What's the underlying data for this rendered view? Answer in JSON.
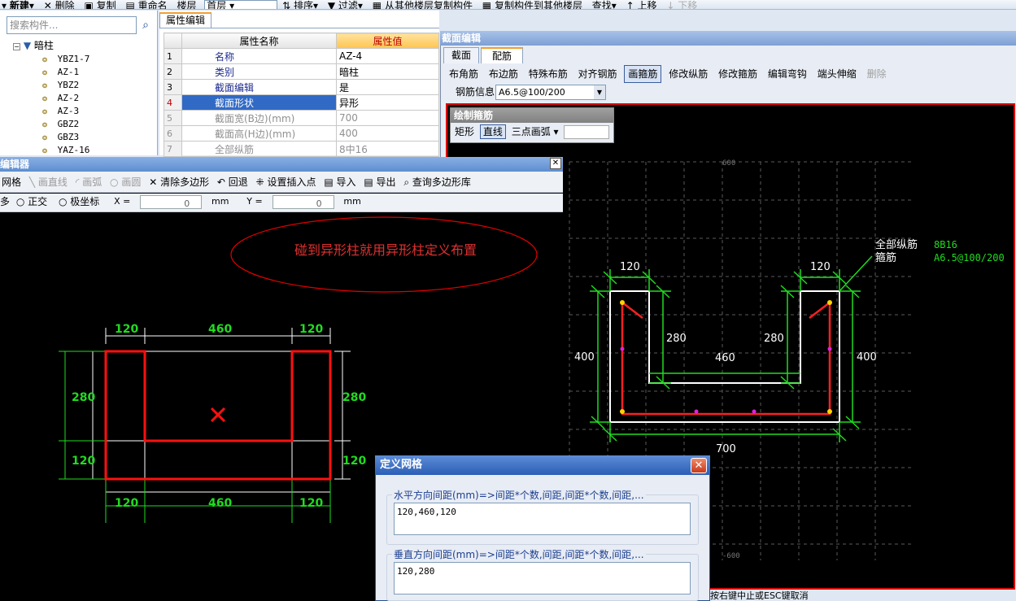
{
  "toolbar": {
    "items": [
      "新建",
      "删除",
      "复制",
      "重命名",
      "楼层",
      "首层",
      "排序",
      "过滤",
      "从其他楼层复制构件",
      "复制构件到其他楼层",
      "查找",
      "上移",
      "下移"
    ]
  },
  "tree": {
    "search_placeholder": "搜索构件...",
    "root": "暗柱",
    "items": [
      "YBZ1-7",
      "AZ-1",
      "YBZ2",
      "AZ-2",
      "AZ-3",
      "GBZ2",
      "GBZ3",
      "YAZ-16"
    ]
  },
  "props": {
    "tab": "属性编辑",
    "col_name": "属性名称",
    "col_value": "属性值",
    "rows": [
      {
        "n": "1",
        "name": "名称",
        "value": "AZ-4"
      },
      {
        "n": "2",
        "name": "类别",
        "value": "暗柱"
      },
      {
        "n": "3",
        "name": "截面编辑",
        "value": "是"
      },
      {
        "n": "4",
        "name": "截面形状",
        "value": "异形"
      },
      {
        "n": "5",
        "name": "截面宽(B边)(mm)",
        "value": "700"
      },
      {
        "n": "6",
        "name": "截面高(H边)(mm)",
        "value": "400"
      },
      {
        "n": "7",
        "name": "全部纵筋",
        "value": "8中16"
      }
    ]
  },
  "section": {
    "title": "截面编辑",
    "tab1": "截面",
    "tab2": "配筋",
    "tools": [
      "布角筋",
      "布边筋",
      "特殊布筋",
      "对齐钢筋",
      "画箍筋",
      "修改纵筋",
      "修改箍筋",
      "编辑弯钩",
      "端头伸缩",
      "删除"
    ],
    "rebar_label": "钢筋信息",
    "rebar_value": "A6.5@100/200",
    "draw_title": "绘制箍筋",
    "draw_modes": [
      "矩形",
      "直线",
      "三点画弧"
    ],
    "annot_all": "全部纵筋",
    "annot_all_val": "8B16",
    "annot_stirrup": "箍筋",
    "annot_stirrup_val": "A6.5@100/200",
    "grid_600": "600",
    "grid_m600": "-600",
    "dims": {
      "a": "120",
      "b": "120",
      "c": "280",
      "d": "280",
      "e": "460",
      "f": "400",
      "g": "400",
      "h": "700"
    },
    "status": "按右键中止或ESC键取消"
  },
  "poly": {
    "title": "编辑器",
    "tools": [
      "网格",
      "画直线",
      "画弧",
      "画圆",
      "清除多边形",
      "回退",
      "设置插入点",
      "导入",
      "导出",
      "查询多边形库"
    ],
    "mode_cut": "多",
    "mode_ortho": "正交",
    "mode_polar": "极坐标",
    "x_label": "X =",
    "x_value": "0",
    "y_label": "Y =",
    "y_value": "0",
    "unit": "mm",
    "note": "碰到异形柱就用异形柱定义布置",
    "dims_top": [
      "120",
      "460",
      "120"
    ],
    "dims_bottom": [
      "120",
      "460",
      "120"
    ],
    "dims_left": [
      "280",
      "120"
    ],
    "dims_right": [
      "280",
      "120"
    ]
  },
  "grid_dialog": {
    "title": "定义网格",
    "h_label": "水平方向间距(mm)=>间距*个数,间距,间距*个数,间距,...",
    "h_value": "120,460,120",
    "v_label": "垂直方向间距(mm)=>间距*个数,间距,间距*个数,间距,...",
    "v_value": "120,280"
  }
}
